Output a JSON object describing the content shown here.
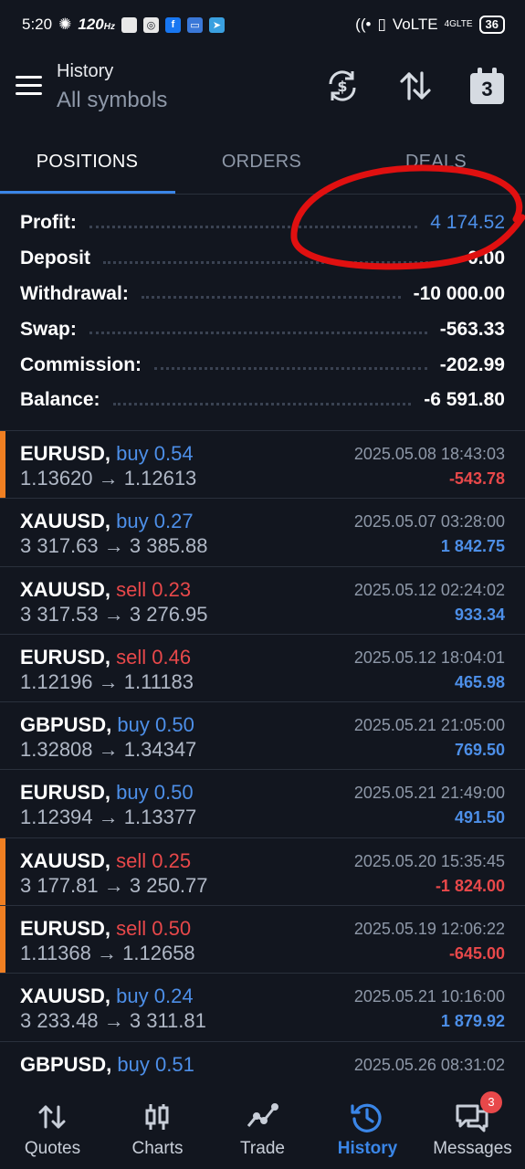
{
  "status_bar": {
    "time": "5:20",
    "refresh_rate": "120",
    "refresh_unit": "Hz",
    "network": "VoLTE",
    "network_small": "4GLTE",
    "battery": "36"
  },
  "header": {
    "title": "History",
    "subtitle": "All symbols",
    "calendar_day": "3"
  },
  "tabs": [
    {
      "label": "POSITIONS",
      "active": true
    },
    {
      "label": "ORDERS",
      "active": false
    },
    {
      "label": "DEALS",
      "active": false
    }
  ],
  "summary": [
    {
      "label": "Profit:",
      "value": "4 174.52"
    },
    {
      "label": "Deposit",
      "value": "0.00"
    },
    {
      "label": "Withdrawal:",
      "value": "-10 000.00"
    },
    {
      "label": "Swap:",
      "value": "-563.33"
    },
    {
      "label": "Commission:",
      "value": "-202.99"
    },
    {
      "label": "Balance:",
      "value": "-6 591.80"
    }
  ],
  "deals": [
    {
      "symbol": "EURUSD,",
      "side": "buy",
      "volume": "0.54",
      "open": "1.13620",
      "close": "1.12613",
      "time": "2025.05.08 18:43:03",
      "profit": "-543.78"
    },
    {
      "symbol": "XAUUSD,",
      "side": "buy",
      "volume": "0.27",
      "open": "3 317.63",
      "close": "3 385.88",
      "time": "2025.05.07 03:28:00",
      "profit": "1 842.75"
    },
    {
      "symbol": "XAUUSD,",
      "side": "sell",
      "volume": "0.23",
      "open": "3 317.53",
      "close": "3 276.95",
      "time": "2025.05.12 02:24:02",
      "profit": "933.34"
    },
    {
      "symbol": "EURUSD,",
      "side": "sell",
      "volume": "0.46",
      "open": "1.12196",
      "close": "1.11183",
      "time": "2025.05.12 18:04:01",
      "profit": "465.98"
    },
    {
      "symbol": "GBPUSD,",
      "side": "buy",
      "volume": "0.50",
      "open": "1.32808",
      "close": "1.34347",
      "time": "2025.05.21 21:05:00",
      "profit": "769.50"
    },
    {
      "symbol": "EURUSD,",
      "side": "buy",
      "volume": "0.50",
      "open": "1.12394",
      "close": "1.13377",
      "time": "2025.05.21 21:49:00",
      "profit": "491.50"
    },
    {
      "symbol": "XAUUSD,",
      "side": "sell",
      "volume": "0.25",
      "open": "3 177.81",
      "close": "3 250.77",
      "time": "2025.05.20 15:35:45",
      "profit": "-1 824.00"
    },
    {
      "symbol": "EURUSD,",
      "side": "sell",
      "volume": "0.50",
      "open": "1.11368",
      "close": "1.12658",
      "time": "2025.05.19 12:06:22",
      "profit": "-645.00"
    },
    {
      "symbol": "XAUUSD,",
      "side": "buy",
      "volume": "0.24",
      "open": "3 233.48",
      "close": "3 311.81",
      "time": "2025.05.21 10:16:00",
      "profit": "1 879.92"
    },
    {
      "symbol": "GBPUSD,",
      "side": "buy",
      "volume": "0.51",
      "open": "",
      "close": "",
      "time": "2025.05.26 08:31:02",
      "profit": ""
    }
  ],
  "bottom_nav": [
    {
      "label": "Quotes",
      "icon": "quotes-icon"
    },
    {
      "label": "Charts",
      "icon": "charts-icon"
    },
    {
      "label": "Trade",
      "icon": "trade-icon"
    },
    {
      "label": "History",
      "icon": "history-icon",
      "active": true
    },
    {
      "label": "Messages",
      "icon": "messages-icon",
      "badge": "3"
    }
  ],
  "colors": {
    "background": "#12161f",
    "accent_blue": "#4d8fe8",
    "loss_red": "#e8484a",
    "marker_orange": "#f07f22"
  }
}
